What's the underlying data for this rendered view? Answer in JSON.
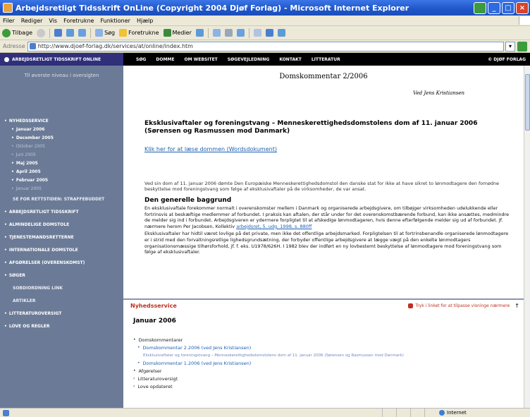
{
  "window": {
    "title": "Arbejdsretligt Tidsskrift OnLine (Copyright 2004 Djøf Forlag) - Microsoft Internet Explorer"
  },
  "menubar": [
    "Filer",
    "Rediger",
    "Vis",
    "Foretrukne",
    "Funktioner",
    "Hjælp"
  ],
  "toolbar": {
    "back": "Tilbage",
    "search": "Søg",
    "favorites": "Foretrukne",
    "media": "Medier"
  },
  "address": {
    "label": "Adresse",
    "url": "http://www.djoef-forlag.dk/services/at/online/index.htm"
  },
  "sitenav": {
    "brand": "ARBEJDSRETLIGT TIDSSKRIFT ONLINE",
    "links": [
      "SØG",
      "DOMME",
      "OM WEBSITET",
      "SØGEVEJLEDNING",
      "KONTAKT",
      "LITTERATUR"
    ],
    "right": "© DJØF FORLAG"
  },
  "sidebar": {
    "tagline": "Til øverste niveau i oversigten",
    "sections": [
      {
        "label": "NYHEDSSERVICE",
        "children": [
          {
            "label": "Januar 2006",
            "dim": false
          },
          {
            "label": "December 2005",
            "dim": false
          },
          {
            "label": "Oktober 2005",
            "dim": true
          },
          {
            "label": "Juni 2005",
            "dim": true
          },
          {
            "label": "Maj 2005",
            "dim": false
          },
          {
            "label": "April 2005",
            "dim": false
          },
          {
            "label": "Februar 2005",
            "dim": false
          },
          {
            "label": "Januar 2005",
            "dim": true
          }
        ]
      }
    ],
    "plain1": "SE FOR RETTSTIDEN: STRAFFEBUDDET",
    "items": [
      "ARBEJDSRETLIGT TIDSSKRIFT",
      "ALMINDELIGE DOMSTOLE",
      "TJENESTEMANDSRETTERNE",
      "INTERNATIONALE DOMSTOLE",
      "AFGØRELSER (OVERENSKOMST)",
      "SØGER"
    ],
    "plain2": "SOBDIORDNING LINK",
    "plain3": "ARTIKLER",
    "items2": [
      "LITTERATUROVERSIGT",
      "LOVE OG REGLER"
    ]
  },
  "document": {
    "title": "Domskommentar 2/2006",
    "author": "Ved Jens Kristiansen",
    "heading": "Eksklusivaftaler og foreningstvang – Menneskerettighedsdomstolens dom af 11. januar 2006 (Sørensen og Rasmussen mod Danmark)",
    "link": "Klik her for at læse dommen (Wordsdokument)",
    "intro": "Ved sin dom af 11. januar 2006 dømte Den Europæiske Menneskerettighedsdomstol den danske stat for ikke at have sikret to lønmodtagere den fornødne beskyttelse mod foreningstvang som følge af eksklusivaftaler på de virksomheder, de var ansat.",
    "subheading": "Den generelle baggrund",
    "body1": "En eksklusivaftale forekommer normalt i overenskomster mellem i Danmark og organiserede arbejdsgivere, om tilbøjger virksomheden udelukkende eller fortrinsvis at beskæftige medlemmer af forbundet. I praksis kan aftalen, der står under for det overenskomstbærende forbund, kan ikke ansættes, medmindre de melder sig ind i forbundet. Arbejdsgiveren er yderrnere forpligtet til at afskedige lønmodtageren, hvis denne efterfølgende melder sig ud af forbundet. Jf. nærmere herom Per Jacobsen, Kollektiv",
    "body_link": "arbejdsret, 5. udg. 1998, s. 880ff",
    "body2": "Eksklusivaftaler har hidtil været lovlige på det private, men ikke det offentlige arbejdsmarked. Forpligtelsen til at fortrinsbenandle organiserede lønmodtagere er i strid med den forvaltningsretlige lighedsgrundsætning, der forbyder offentlige arbejdsgivere at lægge vægt på den enkelte lønmodtagers organisationsmæssige tilhørsforhold, jf. f. eks. U1978/626H. I 1982 blev der indført en ny lovbestemt beskyttelse af lønmodtagere mod foreningstvang som følge af eksklusivaftaler."
  },
  "service": {
    "title": "Nyhedsservice",
    "right_text": "Tryk i linket for at tilpasse visninge nærmere",
    "month": "Januar 2006",
    "list": [
      {
        "level": 1,
        "text": "Domskommentarer",
        "style": "black"
      },
      {
        "level": 2,
        "text": "Domskommentar 2.2006 (ved Jens Kristiansen)",
        "style": "link"
      },
      {
        "level": 3,
        "text": "Eksklusivaftaler og foreningstvang – Menneskerettighedsdomstolens dom af 11. januar 2006 (Sørensen og Rasmussen mod Danmark)",
        "style": "link3"
      },
      {
        "level": 2,
        "text": "Domskommentar 1.2006 (ved Jens Kristiansen)",
        "style": "link"
      },
      {
        "level": 1,
        "text": "Afgørelser",
        "style": "black"
      },
      {
        "level": 1,
        "text": "Litteraturoversigt",
        "style": "black"
      },
      {
        "level": 1,
        "text": "Love opdateret",
        "style": "black"
      }
    ]
  },
  "statusbar": {
    "zone": "Internet"
  },
  "colors": {
    "titlebar": "#1e55c8",
    "sidebar": "#6b7b97",
    "link": "#1c5fb3",
    "accent_red": "#c03020"
  }
}
